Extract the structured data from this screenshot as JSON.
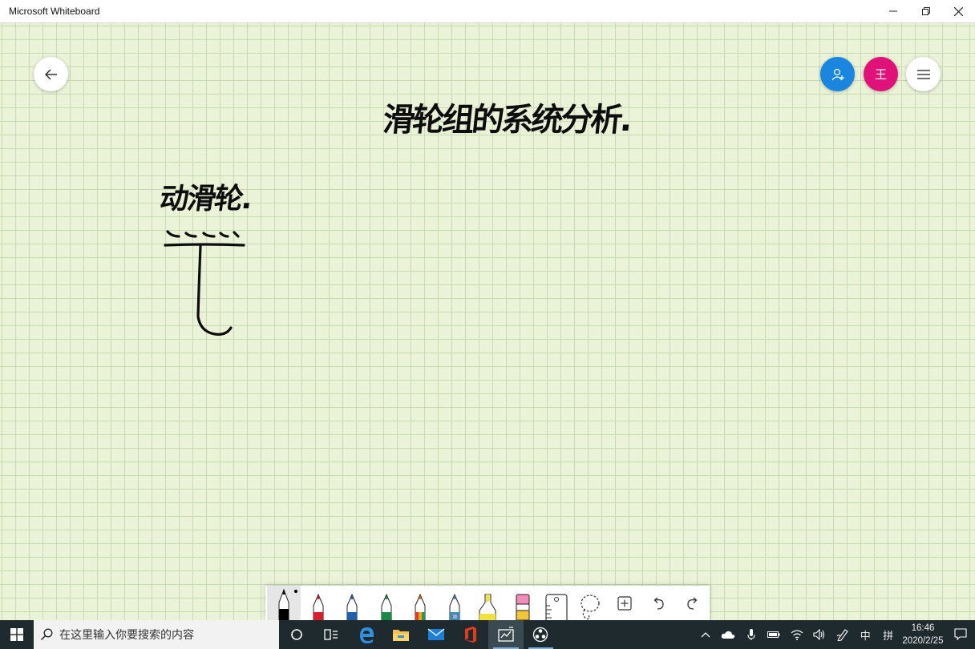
{
  "window": {
    "title": "Microsoft Whiteboard",
    "minimize_icon": "minimize-icon",
    "restore_icon": "restore-icon",
    "close_icon": "close-icon"
  },
  "board": {
    "background_color": "#eaf3d8",
    "grid_color": "#c8d9b4",
    "ink_color": "#0d0d0d",
    "title_ink": "滑轮组的系统分析.",
    "subtitle_ink": "动滑轮.",
    "avatar_initial": "王",
    "invite_color": "#1a86e0",
    "avatar_color": "#e0127a"
  },
  "toolbar": {
    "tools": [
      {
        "name": "pen-black",
        "color": "#000000"
      },
      {
        "name": "pen-red",
        "color": "#d81e2c"
      },
      {
        "name": "pen-blue",
        "color": "#1f5fb0"
      },
      {
        "name": "pen-green",
        "color": "#1a8a48"
      },
      {
        "name": "pen-rainbow",
        "color": "#e06a1e"
      },
      {
        "name": "pen-galaxy",
        "color": "#3a8fb5"
      },
      {
        "name": "highlighter",
        "color": "#f4e040"
      },
      {
        "name": "eraser",
        "color": "#f28bb8"
      },
      {
        "name": "ruler",
        "color": "#444444"
      },
      {
        "name": "lasso",
        "color": "#444444"
      },
      {
        "name": "insert",
        "color": "#444444"
      },
      {
        "name": "undo",
        "color": "#444444"
      },
      {
        "name": "redo",
        "color": "#444444"
      }
    ]
  },
  "taskbar": {
    "search_placeholder": "在这里输入你要搜索的内容",
    "ime_label": "中",
    "ime_mode": "拼",
    "time": "16:46",
    "date": "2020/2/25",
    "apps": [
      "cortana-icon",
      "task-view-icon",
      "edge-icon",
      "file-explorer-icon",
      "mail-icon",
      "office-icon",
      "whiteboard-icon",
      "obs-icon"
    ]
  }
}
